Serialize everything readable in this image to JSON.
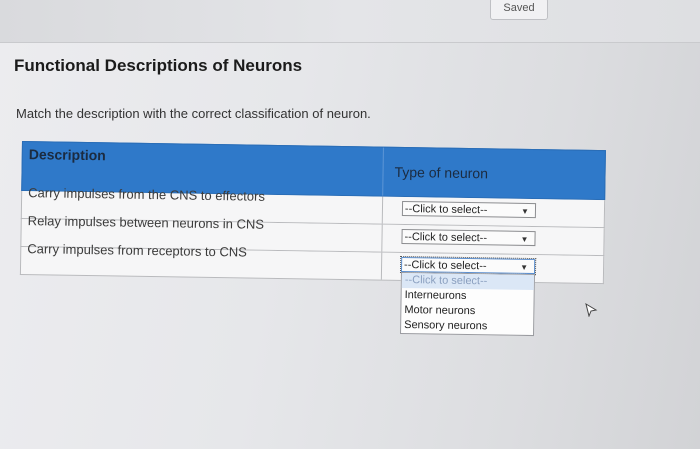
{
  "header": {
    "saved_label": "Saved"
  },
  "page": {
    "title": "Functional Descriptions of Neurons",
    "instruction": "Match the description with the correct classification of neuron."
  },
  "table": {
    "columns": [
      "Description",
      "Type of neuron"
    ],
    "rows": [
      {
        "description": "Carry impulses from the CNS to effectors",
        "selected": "--Click to select--"
      },
      {
        "description": "Relay impulses between neurons in CNS",
        "selected": "--Click to select--"
      },
      {
        "description": "Carry impulses from receptors to CNS",
        "selected": "--Click to select--"
      }
    ]
  },
  "dropdown": {
    "open_row": 2,
    "options": [
      "--Click to select--",
      "Interneurons",
      "Motor neurons",
      "Sensory neurons"
    ],
    "highlighted_index": 0
  },
  "colors": {
    "header_blue": "#2f79c9",
    "background": "#e6e7ea"
  },
  "icons": {
    "arrow": "chevron-down-icon",
    "cursor": "mouse-cursor-icon"
  }
}
